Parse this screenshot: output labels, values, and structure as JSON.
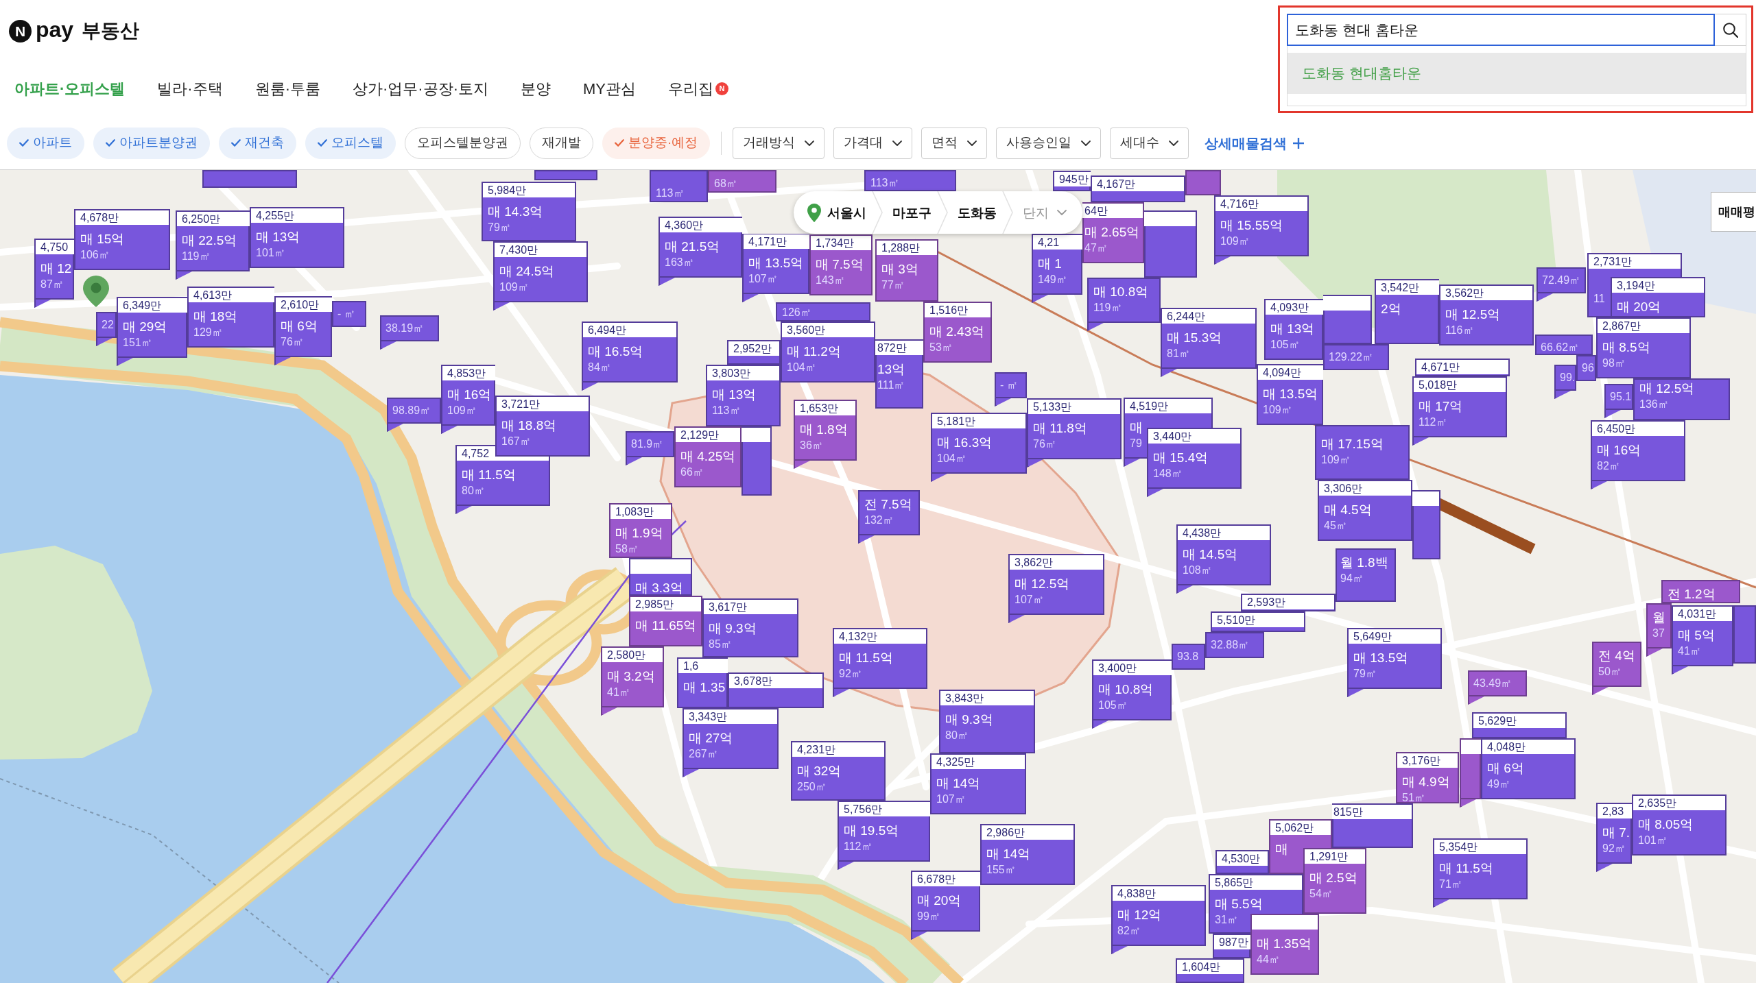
{
  "header": {
    "logo_mark": "N",
    "brand": "pay",
    "service": "부동산"
  },
  "search": {
    "value": "도화동 현대 홈타운",
    "highlighted": true,
    "suggestions": [
      {
        "label": "도화동 현대홈타운",
        "selected": true
      }
    ]
  },
  "tabs": [
    {
      "label": "아파트·오피스텔",
      "selected": true
    },
    {
      "label": "빌라·주택",
      "selected": false
    },
    {
      "label": "원룸·투룸",
      "selected": false
    },
    {
      "label": "상가·업무·공장·토지",
      "selected": false
    },
    {
      "label": "분양",
      "selected": false
    },
    {
      "label": "MY관심",
      "selected": false
    },
    {
      "label": "우리집",
      "selected": false,
      "badge": "N"
    }
  ],
  "filters": {
    "chips": [
      {
        "label": "아파트",
        "selected": true,
        "color": "#3070d6"
      },
      {
        "label": "아파트분양권",
        "selected": true,
        "color": "#3070d6"
      },
      {
        "label": "재건축",
        "selected": true,
        "color": "#3070d6"
      },
      {
        "label": "오피스텔",
        "selected": true,
        "color": "#3070d6"
      },
      {
        "label": "오피스텔분양권",
        "selected": false
      },
      {
        "label": "재개발",
        "selected": false
      },
      {
        "label": "분양중·예정",
        "selected": true,
        "color": "#e8643c"
      }
    ],
    "dropdowns": [
      "거래방식",
      "가격대",
      "면적",
      "사용승인일",
      "세대수"
    ],
    "detail_search": "상세매물검색"
  },
  "breadcrumb": {
    "items": [
      "서울시",
      "마포구",
      "도화동"
    ],
    "level": "단지"
  },
  "map": {
    "view_toggle": "매매평",
    "markers": [
      {
        "kind": "stub",
        "color": "#7856dc"
      },
      {
        "kind": "stub",
        "color": "#7856dc"
      },
      {
        "kind": "full",
        "price": "4,750",
        "deal": "매 12",
        "area": "87㎡",
        "color": "#7856dc"
      },
      {
        "kind": "full",
        "price": "4,678만",
        "deal": "매 15억",
        "area": "106㎡",
        "color": "#7856dc"
      },
      {
        "kind": "full",
        "price": "6,250만",
        "deal": "매 22.5억",
        "area": "119㎡",
        "color": "#7856dc"
      },
      {
        "kind": "full",
        "price": "4,255만",
        "deal": "매 13억",
        "area": "101㎡",
        "color": "#7856dc"
      },
      {
        "kind": "full",
        "price": "5,984만",
        "deal": "매 14.3억",
        "area": "79㎡",
        "color": "#7856dc"
      },
      {
        "kind": "stub",
        "area": "113㎡",
        "color": "#7856dc"
      },
      {
        "kind": "stub",
        "area": "68㎡",
        "color": "#9b58cc"
      },
      {
        "kind": "stub",
        "area": "113㎡",
        "color": "#7856dc"
      },
      {
        "kind": "full",
        "price": "945만",
        "color": "#7856dc"
      },
      {
        "kind": "full",
        "price": "4,167만",
        "color": "#7856dc"
      },
      {
        "kind": "stub",
        "color": "#9b58cc"
      },
      {
        "kind": "area",
        "area": "22",
        "color": "#7856dc"
      },
      {
        "kind": "full",
        "price": "6,349만",
        "deal": "매 29억",
        "area": "151㎡",
        "color": "#7856dc"
      },
      {
        "kind": "full",
        "price": "4,613만",
        "deal": "매 18억",
        "area": "129㎡",
        "color": "#7856dc"
      },
      {
        "kind": "full",
        "price": "2,610만",
        "deal": "매 6억",
        "area": "76㎡",
        "color": "#7856dc"
      },
      {
        "kind": "area",
        "area": "- ㎡",
        "color": "#7856dc"
      },
      {
        "kind": "full",
        "price": "7,430만",
        "deal": "매 24.5억",
        "area": "109㎡",
        "color": "#7856dc"
      },
      {
        "kind": "full",
        "price": "4,360만",
        "deal": "매 21.5억",
        "area": "163㎡",
        "color": "#7856dc"
      },
      {
        "kind": "full",
        "price": "4,171만",
        "deal": "매 13.5억",
        "area": "107㎡",
        "color": "#7856dc"
      },
      {
        "kind": "full",
        "price": "1,734만",
        "deal": "매 7.5억",
        "area": "143㎡",
        "color": "#9b58cc"
      },
      {
        "kind": "full",
        "price": "1,288만",
        "deal": "매 3억",
        "area": "77㎡",
        "color": "#9b58cc"
      },
      {
        "kind": "area",
        "area": "38.19㎡",
        "color": "#7856dc"
      },
      {
        "kind": "plain",
        "area": "126㎡",
        "color": "#7856dc"
      },
      {
        "kind": "area",
        "area": "98.89㎡",
        "color": "#7856dc"
      },
      {
        "kind": "full",
        "price": "4,853만",
        "deal": "매 16억",
        "area": "109㎡",
        "color": "#7856dc"
      },
      {
        "kind": "full",
        "price": "6,494만",
        "deal": "매 16.5억",
        "area": "84㎡",
        "color": "#7856dc"
      },
      {
        "kind": "full",
        "price": "2,952만",
        "color": "#7856dc"
      },
      {
        "kind": "full",
        "price": "3,721만",
        "deal": "매 18.8억",
        "area": "167㎡",
        "color": "#7856dc"
      },
      {
        "kind": "full",
        "price": "3,803만",
        "deal": "매 13억",
        "area": "113㎡",
        "color": "#7856dc"
      },
      {
        "kind": "full",
        "price": "3,560만",
        "deal": "매 11.2억",
        "area": "104㎡",
        "color": "#7856dc"
      },
      {
        "kind": "full",
        "price": "4,752",
        "deal": "매 11.5억",
        "area": "80㎡",
        "color": "#7856dc"
      },
      {
        "kind": "area",
        "area": "81.9㎡",
        "color": "#7856dc"
      },
      {
        "kind": "full",
        "price": "2,129만",
        "deal": "매 4.25억",
        "area": "66㎡",
        "color": "#9b58cc"
      },
      {
        "kind": "full",
        "color": "#7856dc"
      },
      {
        "kind": "full",
        "price": "1,653만",
        "deal": "매 1.8억",
        "area": "36㎡",
        "color": "#9b58cc"
      },
      {
        "kind": "full",
        "price": "872만",
        "deal": "13억",
        "area": "111㎡",
        "color": "#7856dc"
      },
      {
        "kind": "full",
        "price": "1,516만",
        "deal": "매 2.43억",
        "area": "53㎡",
        "color": "#9b58cc"
      },
      {
        "kind": "full",
        "price": "4,21",
        "deal": "매 1",
        "area": "149㎡",
        "color": "#7856dc"
      },
      {
        "kind": "full",
        "price": "64만",
        "deal": "매 2.65억",
        "area": "47㎡",
        "color": "#9b58cc"
      },
      {
        "kind": "full",
        "color": "#7856dc"
      },
      {
        "kind": "full",
        "price": "4,716만",
        "deal": "매 15.55억",
        "area": "109㎡",
        "color": "#7856dc"
      },
      {
        "kind": "plain",
        "deal": "매 10.8억",
        "area": "119㎡",
        "color": "#7856dc"
      },
      {
        "kind": "area",
        "area": "- ㎡",
        "color": "#7856dc"
      },
      {
        "kind": "full",
        "price": "6,244만",
        "deal": "매 15.3억",
        "area": "81㎡",
        "color": "#7856dc"
      },
      {
        "kind": "full",
        "price": "4,093만",
        "deal": "매 13억",
        "area": "105㎡",
        "color": "#7856dc"
      },
      {
        "kind": "full",
        "color": "#7856dc"
      },
      {
        "kind": "full",
        "price": "3,542만",
        "deal": "2억",
        "color": "#7856dc"
      },
      {
        "kind": "full",
        "price": "5,181만",
        "deal": "매 16.3억",
        "area": "104㎡",
        "color": "#7856dc"
      },
      {
        "kind": "full",
        "price": "5,133만",
        "deal": "매 11.8억",
        "area": "76㎡",
        "color": "#7856dc"
      },
      {
        "kind": "full",
        "price": "4,519만",
        "deal": "매",
        "area": "79",
        "color": "#7856dc"
      },
      {
        "kind": "full",
        "price": "4,094만",
        "deal": "매 13.5억",
        "area": "109㎡",
        "color": "#7856dc"
      },
      {
        "kind": "area",
        "area": "129.22㎡",
        "color": "#7856dc"
      },
      {
        "kind": "full",
        "price": "3,562만",
        "deal": "매 12.5억",
        "area": "116㎡",
        "color": "#7856dc"
      },
      {
        "kind": "area",
        "area": "72.49㎡",
        "color": "#7856dc"
      },
      {
        "kind": "full",
        "price": "2,731만",
        "area": "11",
        "color": "#7856dc"
      },
      {
        "kind": "full",
        "price": "3,194만",
        "deal": "매 20억",
        "color": "#7856dc"
      },
      {
        "kind": "area",
        "area": "66.62㎡",
        "color": "#7856dc"
      },
      {
        "kind": "full",
        "price": "4,671만",
        "color": "#7856dc"
      },
      {
        "kind": "full",
        "price": "1,083만",
        "deal": "매 1.9억",
        "area": "58㎡",
        "color": "#9b58cc"
      },
      {
        "kind": "plain",
        "deal": "전 7.5억",
        "area": "132㎡",
        "color": "#7856dc"
      },
      {
        "kind": "full",
        "price": "3,440만",
        "deal": "매 15.4억",
        "area": "148㎡",
        "color": "#7856dc"
      },
      {
        "kind": "full",
        "deal": "매 17.15억",
        "area": "109㎡",
        "color": "#7856dc"
      },
      {
        "kind": "full",
        "price": "5,018만",
        "deal": "매 17억",
        "area": "112㎡",
        "color": "#7856dc"
      },
      {
        "kind": "area",
        "area": "99.",
        "color": "#7856dc"
      },
      {
        "kind": "area",
        "area": "96",
        "color": "#7856dc"
      },
      {
        "kind": "full",
        "price": "2,867만",
        "deal": "매 8.5억",
        "area": "98㎡",
        "color": "#7856dc"
      },
      {
        "kind": "area",
        "area": "95.1",
        "color": "#7856dc"
      },
      {
        "kind": "full",
        "deal": "매 12.5억",
        "area": "136㎡",
        "color": "#7856dc"
      },
      {
        "kind": "full",
        "deal": "매 3.3억",
        "color": "#7856dc"
      },
      {
        "kind": "full",
        "price": "2,985만",
        "deal": "매 11.65억",
        "color": "#9b58cc"
      },
      {
        "kind": "full",
        "price": "2,580만",
        "deal": "매 3.2억",
        "area": "41㎡",
        "color": "#9b58cc"
      },
      {
        "kind": "full",
        "price": "3,617만",
        "deal": "매 9.3억",
        "area": "85㎡",
        "color": "#7856dc"
      },
      {
        "kind": "full",
        "price": "3,862만",
        "deal": "매 12.5억",
        "area": "107㎡",
        "color": "#7856dc"
      },
      {
        "kind": "full",
        "price": "4,438만",
        "deal": "매 14.5억",
        "area": "108㎡",
        "color": "#7856dc"
      },
      {
        "kind": "full",
        "price": "3,306만",
        "deal": "매 4.5억",
        "area": "45㎡",
        "color": "#7856dc"
      },
      {
        "kind": "full",
        "price": "6,450만",
        "deal": "매 16억",
        "area": "82㎡",
        "color": "#7856dc"
      },
      {
        "kind": "full",
        "price": "2,593만",
        "color": "#7856dc"
      },
      {
        "kind": "plain",
        "deal": "월 1.8백",
        "area": "94㎡",
        "color": "#7856dc"
      },
      {
        "kind": "full",
        "color": "#7856dc"
      },
      {
        "kind": "plain",
        "deal": "전 1.2억",
        "color": "#9b58cc"
      },
      {
        "kind": "full",
        "price": "1,6",
        "deal": "매 1.35",
        "color": "#7856dc"
      },
      {
        "kind": "full",
        "price": "3,678만",
        "color": "#7856dc"
      },
      {
        "kind": "full",
        "price": "4,132만",
        "deal": "매 11.5억",
        "area": "92㎡",
        "color": "#7856dc"
      },
      {
        "kind": "full",
        "price": "5,510만",
        "color": "#7856dc"
      },
      {
        "kind": "full",
        "price": "3,343만",
        "deal": "매 27억",
        "area": "267㎡",
        "color": "#7856dc"
      },
      {
        "kind": "full",
        "price": "4,231만",
        "deal": "매 32억",
        "area": "250㎡",
        "color": "#7856dc"
      },
      {
        "kind": "full",
        "price": "3,843만",
        "deal": "매 9.3억",
        "area": "80㎡",
        "color": "#7856dc"
      },
      {
        "kind": "full",
        "price": "3,400만",
        "deal": "매 10.8억",
        "area": "105㎡",
        "color": "#7856dc"
      },
      {
        "kind": "area",
        "area": "93.8",
        "color": "#7856dc"
      },
      {
        "kind": "area",
        "area": "32.88㎡",
        "color": "#7856dc"
      },
      {
        "kind": "full",
        "price": "5,649만",
        "deal": "매 13.5억",
        "area": "79㎡",
        "color": "#7856dc"
      },
      {
        "kind": "area",
        "area": "43.49㎡",
        "color": "#9b58cc"
      },
      {
        "kind": "plain",
        "deal": "전 4억",
        "area": "50㎡",
        "color": "#9b58cc"
      },
      {
        "kind": "plain",
        "deal": "월",
        "area": "37",
        "color": "#9b58cc"
      },
      {
        "kind": "full",
        "price": "4,031만",
        "deal": "매 5억",
        "area": "41㎡",
        "color": "#7856dc"
      },
      {
        "kind": "stub",
        "color": "#7856dc"
      },
      {
        "kind": "full",
        "price": "5,629만",
        "color": "#7856dc"
      },
      {
        "kind": "full",
        "price": "5,756만",
        "deal": "매 19.5억",
        "area": "112㎡",
        "color": "#7856dc"
      },
      {
        "kind": "full",
        "price": "4,325만",
        "deal": "매 14억",
        "area": "107㎡",
        "color": "#7856dc"
      },
      {
        "kind": "full",
        "price": "3,176만",
        "deal": "매 4.9억",
        "area": "51㎡",
        "color": "#9b58cc"
      },
      {
        "kind": "full",
        "price": "6,678만",
        "deal": "매 20억",
        "area": "99㎡",
        "color": "#7856dc"
      },
      {
        "kind": "full",
        "price": "2,986만",
        "deal": "매 14억",
        "area": "155㎡",
        "color": "#7856dc"
      },
      {
        "kind": "full",
        "price": "4,530만",
        "color": "#7856dc"
      },
      {
        "kind": "full",
        "price": "5,062만",
        "deal": "매",
        "color": "#9b58cc"
      },
      {
        "kind": "full",
        "price": "815만",
        "color": "#7856dc"
      },
      {
        "kind": "full",
        "color": "#9b58cc"
      },
      {
        "kind": "full",
        "price": "4,048만",
        "deal": "매 6억",
        "area": "49㎡",
        "color": "#7856dc"
      },
      {
        "kind": "full",
        "price": "4,838만",
        "deal": "매 12억",
        "area": "82㎡",
        "color": "#7856dc"
      },
      {
        "kind": "full",
        "price": "5,865만",
        "deal": "매 5.5억",
        "area": "31㎡",
        "color": "#7856dc"
      },
      {
        "kind": "full",
        "price": "1,291만",
        "deal": "매 2.5억",
        "area": "54㎡",
        "color": "#9b58cc"
      },
      {
        "kind": "full",
        "price": "5,354만",
        "deal": "매 11.5억",
        "area": "71㎡",
        "color": "#7856dc"
      },
      {
        "kind": "full",
        "price": "2,83",
        "deal": "매 7.",
        "area": "92㎡",
        "color": "#7856dc"
      },
      {
        "kind": "full",
        "price": "2,635만",
        "deal": "매 8.05억",
        "area": "101㎡",
        "color": "#7856dc"
      },
      {
        "kind": "full",
        "price": "987만",
        "color": "#7856dc"
      },
      {
        "kind": "full",
        "price": "1,604만",
        "color": "#7856dc"
      },
      {
        "kind": "full",
        "deal": "매 1.35억",
        "area": "44㎡",
        "color": "#9b58cc"
      }
    ]
  }
}
